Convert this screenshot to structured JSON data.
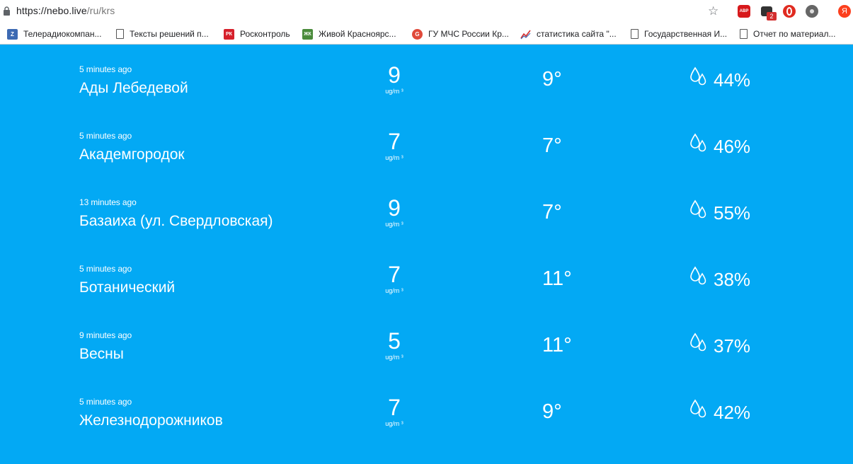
{
  "browser": {
    "url_host": "https://nebo.live",
    "url_path": "/ru/krs",
    "extensions": {
      "abp_label": "ABP",
      "msg_badge": "2",
      "yandex_label": "Я"
    },
    "bookmarks": [
      {
        "label": "Телерадиокомпан...",
        "icon": "z-icon",
        "icon_text": "Z"
      },
      {
        "label": "Тексты решений п...",
        "icon": "document-icon",
        "icon_text": ""
      },
      {
        "label": "Росконтроль",
        "icon": "roskontrol-icon",
        "icon_text": "РК"
      },
      {
        "label": "Живой Красноярс...",
        "icon": "zhk-icon",
        "icon_text": "ЖК"
      },
      {
        "label": "ГУ МЧС России Кр...",
        "icon": "google-plus-icon",
        "icon_text": "G"
      },
      {
        "label": "статистика сайта \"...",
        "icon": "chart-line-icon",
        "icon_text": ""
      },
      {
        "label": "Государственная И...",
        "icon": "document-icon",
        "icon_text": ""
      },
      {
        "label": "Отчет по материал...",
        "icon": "document-icon",
        "icon_text": ""
      }
    ]
  },
  "stations": [
    {
      "time": "5 minutes ago",
      "name": "Ады Лебедевой",
      "pm": "9",
      "unit": "ug/m ³",
      "temp": "9°",
      "humidity": "44%"
    },
    {
      "time": "5 minutes ago",
      "name": "Академгородок",
      "pm": "7",
      "unit": "ug/m ³",
      "temp": "7°",
      "humidity": "46%"
    },
    {
      "time": "13 minutes ago",
      "name": "Базаиха (ул. Свердловская)",
      "pm": "9",
      "unit": "ug/m ³",
      "temp": "7°",
      "humidity": "55%"
    },
    {
      "time": "5 minutes ago",
      "name": "Ботанический",
      "pm": "7",
      "unit": "ug/m ³",
      "temp": "11°",
      "humidity": "38%"
    },
    {
      "time": "9 minutes ago",
      "name": "Весны",
      "pm": "5",
      "unit": "ug/m ³",
      "temp": "11°",
      "humidity": "37%"
    },
    {
      "time": "5 minutes ago",
      "name": "Железнодорожников",
      "pm": "7",
      "unit": "ug/m ³",
      "temp": "9°",
      "humidity": "42%"
    }
  ],
  "colors": {
    "background": "#03a9f4",
    "text": "#ffffff"
  }
}
